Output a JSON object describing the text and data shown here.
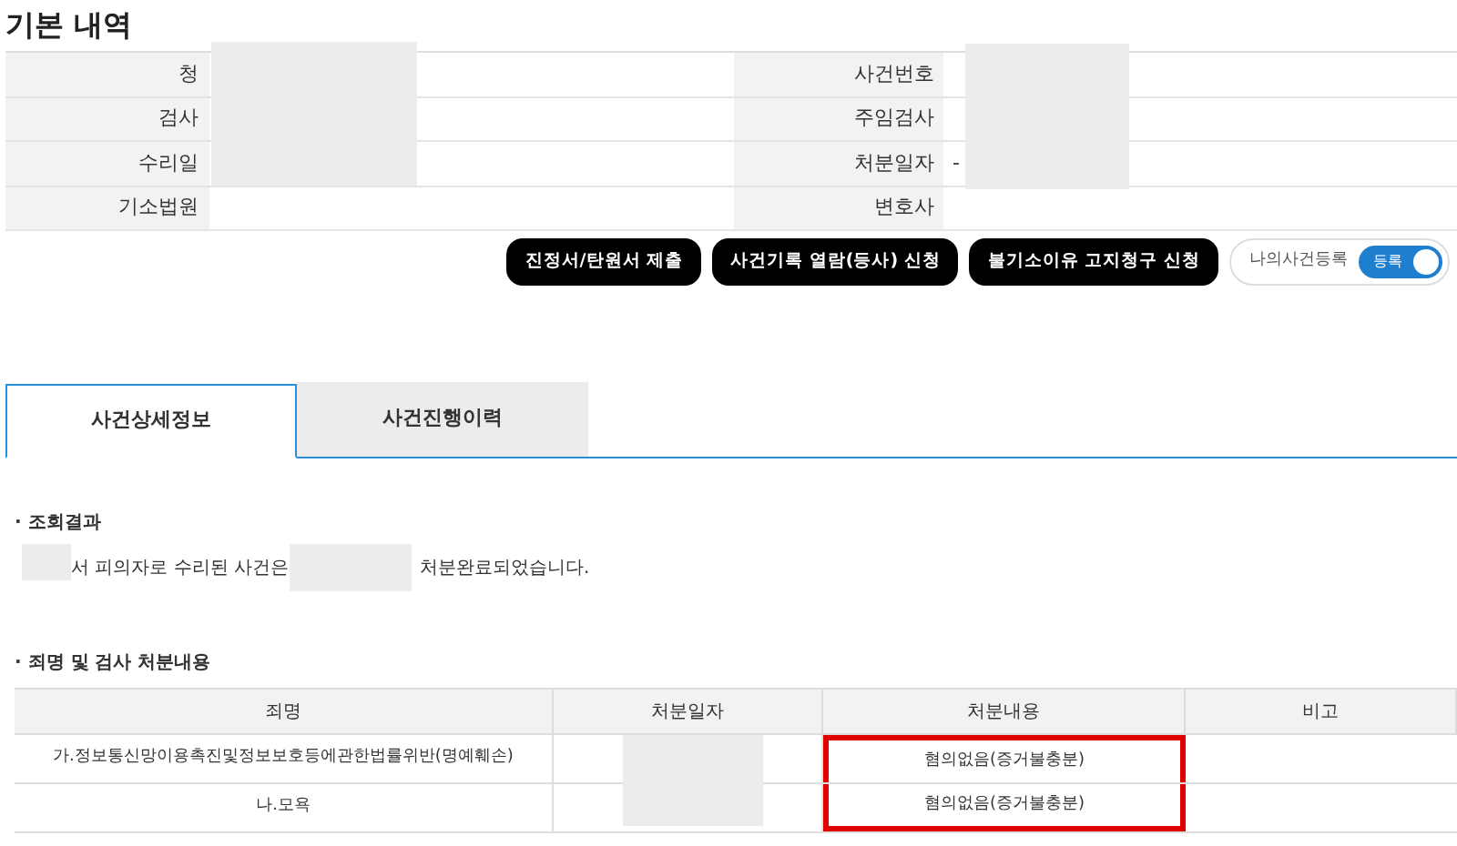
{
  "title": "기본 내역",
  "info_rows": [
    {
      "left_label": "청",
      "right_label": "사건번호",
      "right_value": ""
    },
    {
      "left_label": "검사",
      "right_label": "주임검사",
      "right_value": ""
    },
    {
      "left_label": "수리일",
      "right_label": "처분일자",
      "right_value": "-"
    },
    {
      "left_label": "기소법원",
      "right_label": "변호사",
      "right_value": ""
    }
  ],
  "buttons": [
    "진정서/탄원서 제출",
    "사건기록 열람(등사) 신청",
    "불기소이유 고지청구 신청"
  ],
  "my_case": {
    "label": "나의사건등록",
    "switch_text": "등록",
    "on": true
  },
  "tabs": [
    {
      "label": "사건상세정보",
      "selected": true
    },
    {
      "label": "사건진행이력",
      "selected": false
    }
  ],
  "result": {
    "heading": "· 조회결과",
    "sentence_part_1": "서 피의자로 수리된 사건은",
    "sentence_part_2": "처분완료되었습니다."
  },
  "disposition": {
    "heading": "· 죄명 및 검사 처분내용",
    "columns": [
      "죄명",
      "처분일자",
      "처분내용",
      "비고"
    ],
    "rows": [
      {
        "charge": "가.정보통신망이용촉진및정보보호등에관한법률위반(명예훼손)",
        "date": "",
        "content": "혐의없음(증거불충분)",
        "note": "",
        "highlighted": true
      },
      {
        "charge": "나.모욕",
        "date": "",
        "content": "혐의없음(증거불충분)",
        "note": "",
        "highlighted": true
      }
    ]
  }
}
